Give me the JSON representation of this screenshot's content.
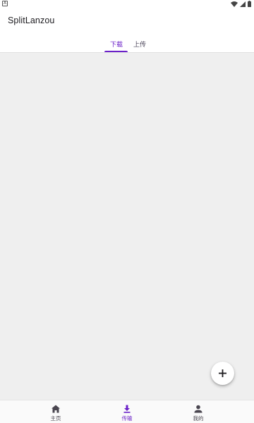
{
  "app": {
    "title": "SplitLanzou"
  },
  "status_bar": {
    "left_icon_label": "A",
    "icons": [
      "wifi-icon",
      "signal-icon",
      "battery-icon"
    ]
  },
  "tabs": [
    {
      "label": "下载",
      "active": true
    },
    {
      "label": "上传",
      "active": false
    }
  ],
  "fab": {
    "icon": "plus-icon"
  },
  "bottom_nav": [
    {
      "label": "主页",
      "icon": "home-icon",
      "active": false
    },
    {
      "label": "传输",
      "icon": "download-icon",
      "active": true
    },
    {
      "label": "我的",
      "icon": "person-icon",
      "active": false
    }
  ],
  "colors": {
    "accent": "#6b21c8",
    "content_background": "#efefef",
    "surface": "#ffffff",
    "nav_background": "#fafafa"
  }
}
